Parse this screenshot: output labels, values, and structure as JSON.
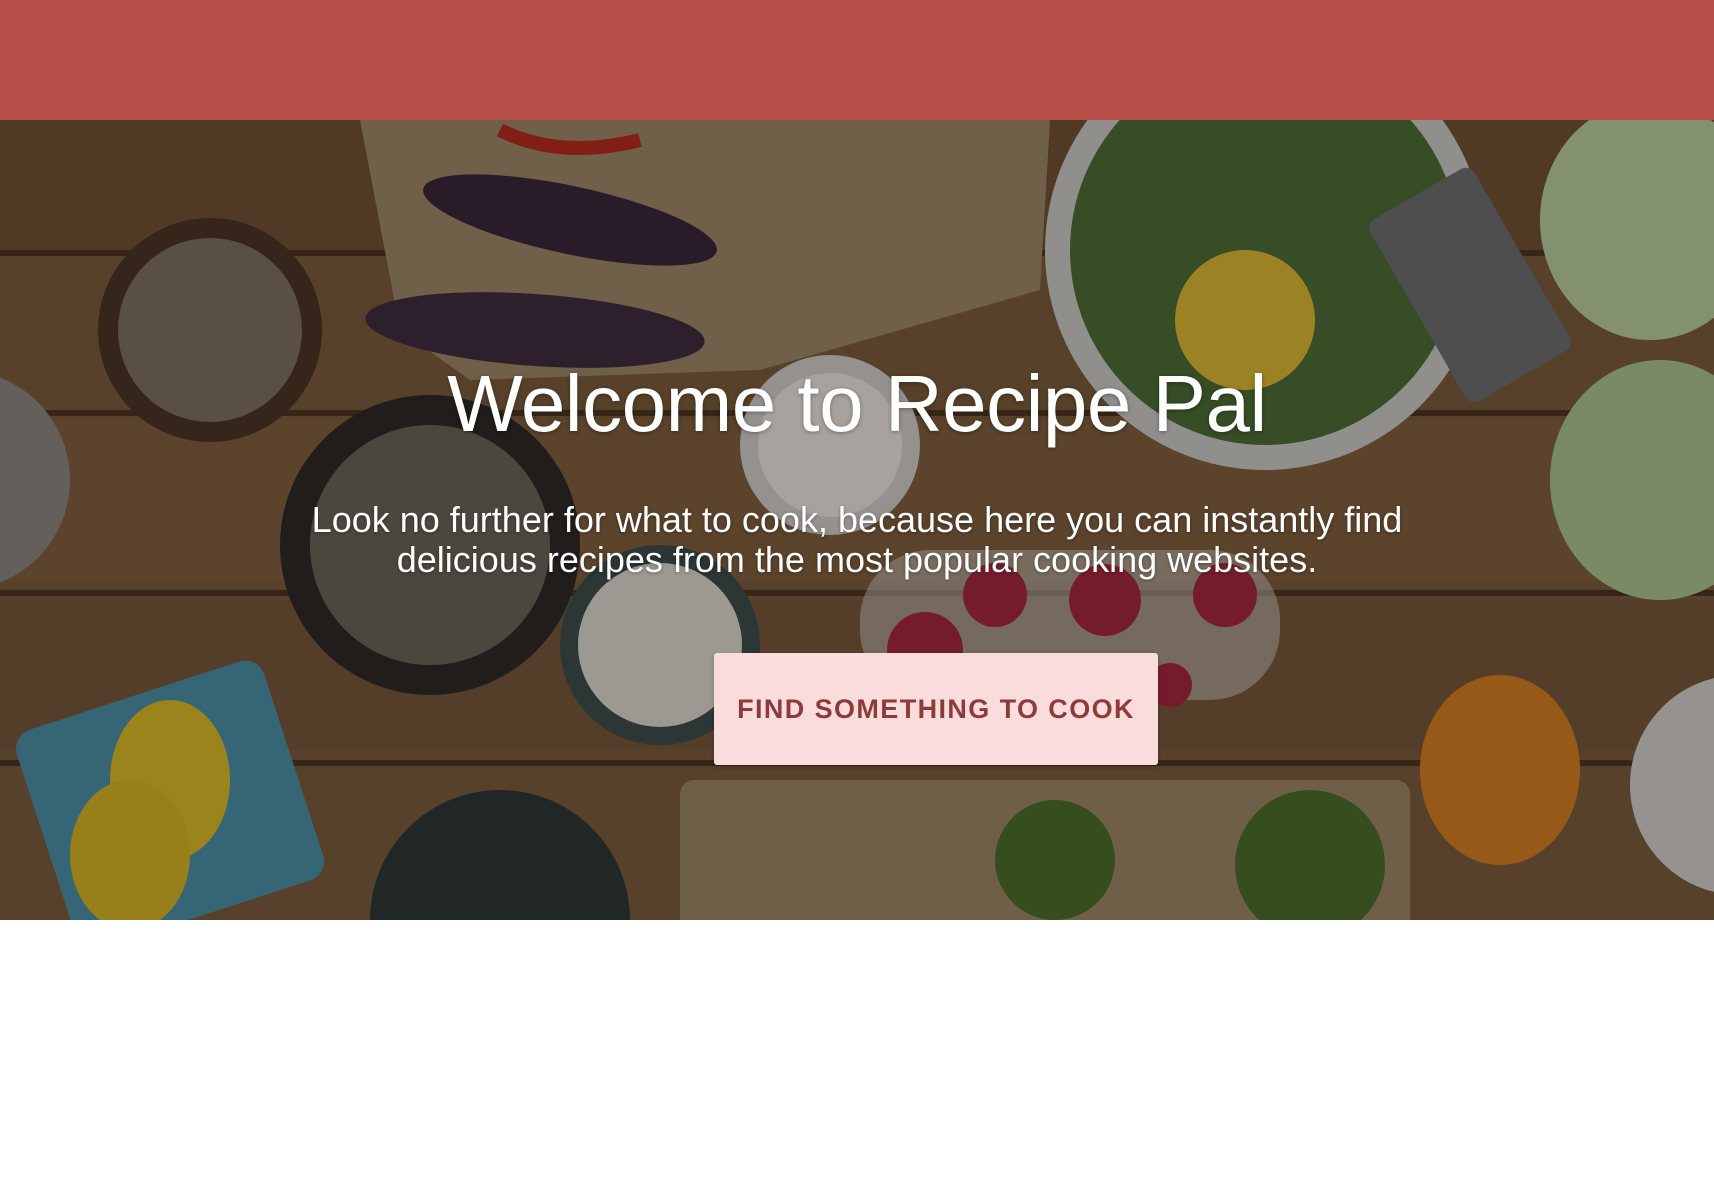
{
  "header": {
    "background_color": "#b84e48"
  },
  "hero": {
    "background_image": "kitchen-table-vegetables",
    "title": "Welcome to Recipe Pal",
    "subtitle": "Look no further for what to cook, because here you can instantly find delicious recipes from the most popular cooking websites.",
    "cta_label": "FIND SOMETHING TO COOK",
    "cta_background": "#fadcdc",
    "cta_text_color": "#8d3b39"
  }
}
